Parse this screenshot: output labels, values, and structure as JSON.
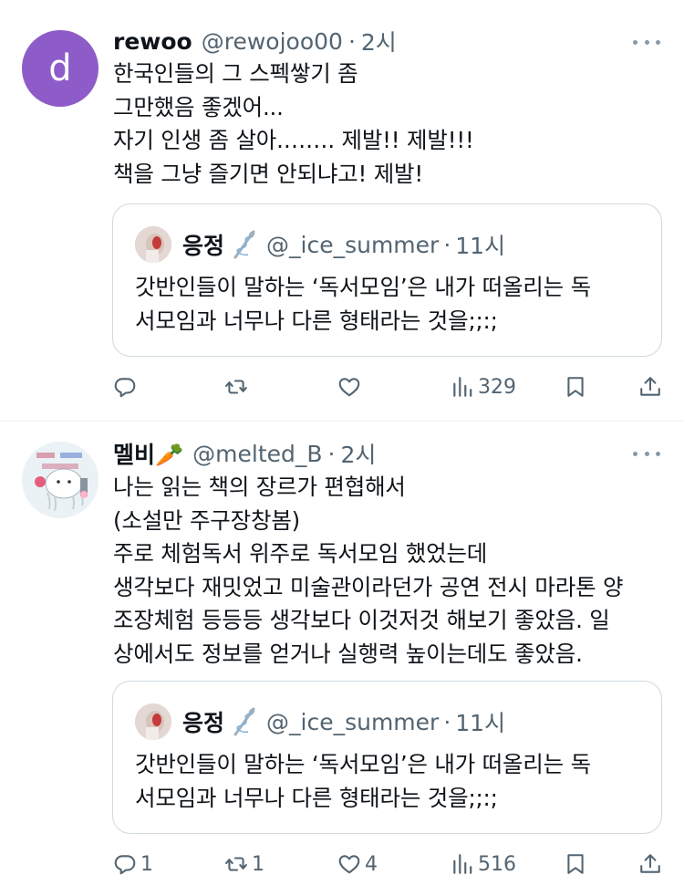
{
  "tweets": [
    {
      "avatar_letter": "d",
      "avatar_color": "#8e5cc8",
      "display_name": "rewoo",
      "handle": "@rewojoo00",
      "separator": "·",
      "time": "2시",
      "text": "한국인들의 그 스펙쌓기 좀\n그만했음 좋겠어...\n자기 인생 좀 살아.……. 제발!! 제발!!!\n책을 그냥 즐기면 안되냐고! 제발!",
      "quote": {
        "display_name": "응정",
        "handle": "@_ice_summer",
        "separator": "·",
        "time": "11시",
        "text": "갓반인들이 말하는 ‘독서모임’은 내가 떠올리는 독\n서모임과 너무나 다른 형태라는 것을;;:;"
      },
      "actions": {
        "replies": "",
        "retweets": "",
        "likes": "",
        "views": "329"
      }
    },
    {
      "display_name": "멜비🥕",
      "handle": "@melted_B",
      "separator": "·",
      "time": "2시",
      "text": "나는 읽는 책의 장르가 편협해서\n(소설만 주구장창봄)\n주로 체험독서 위주로 독서모임 했었는데\n생각보다 재밋었고 미술관이라던가 공연 전시 마라톤 양\n조장체험 등등등 생각보다 이것저것 해보기 좋았음. 일\n상에서도 정보를 얻거나 실행력 높이는데도 좋았음.",
      "quote": {
        "display_name": "응정",
        "handle": "@_ice_summer",
        "separator": "·",
        "time": "11시",
        "text": "갓반인들이 말하는 ‘독서모임’은 내가 떠올리는 독\n서모임과 너무나 다른 형태라는 것을;;:;"
      },
      "actions": {
        "replies": "1",
        "retweets": "1",
        "likes": "4",
        "views": "516"
      }
    }
  ],
  "icons": [
    "more-icon",
    "reply-icon",
    "retweet-icon",
    "like-icon",
    "views-icon",
    "bookmark-icon",
    "share-icon",
    "needle-thread-icon"
  ],
  "colors": {
    "text": "#0f1419",
    "secondary": "#536471",
    "border": "#cfd9de",
    "divider": "#eff3f4"
  }
}
